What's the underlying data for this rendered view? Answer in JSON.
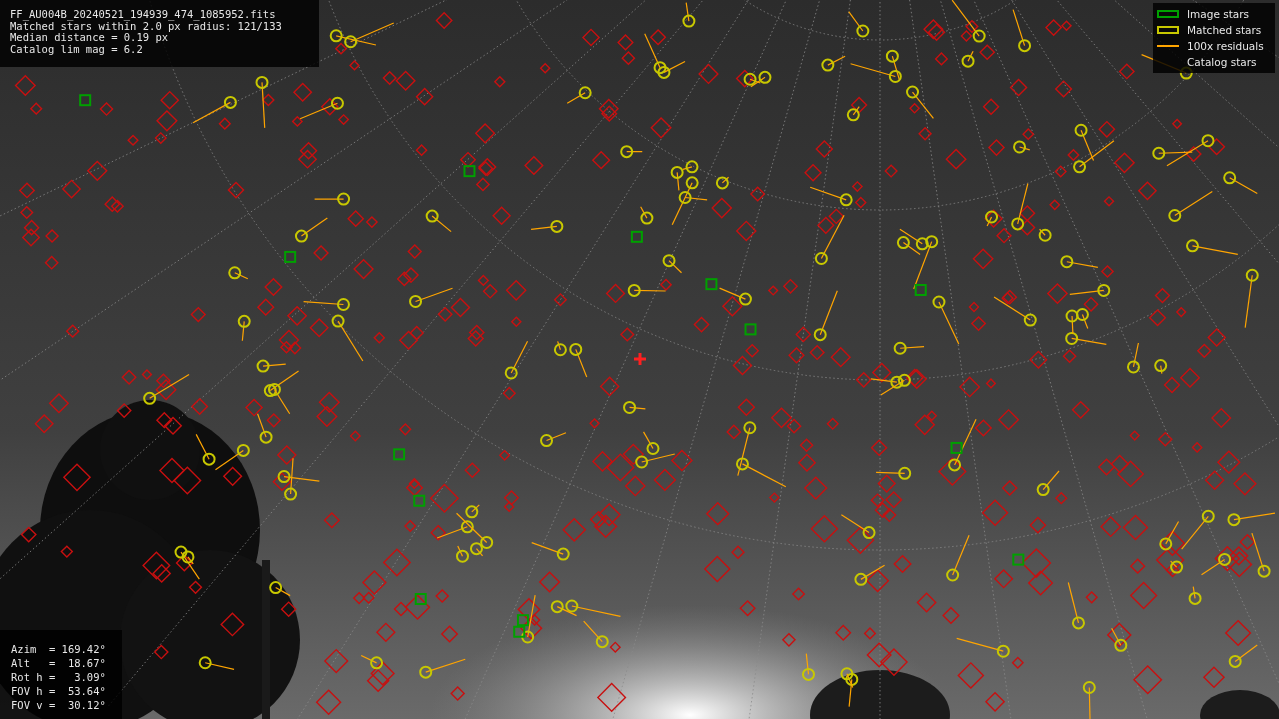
{
  "info_panel": {
    "lines": [
      "FF_AU004B_20240521_194939_474_1085952.fits",
      "Matched stars within 2.0 px radius: 121/133",
      "Median distance = 0.19 px",
      "Catalog lim mag = 6.2"
    ]
  },
  "legend": {
    "items": [
      {
        "label": "Image stars"
      },
      {
        "kind": "matched",
        "label": "Matched stars"
      },
      {
        "kind": "residual",
        "label": "100x residuals"
      },
      {
        "kind": "catalog",
        "label": "Catalog stars"
      }
    ]
  },
  "pointing_panel": {
    "lines": [
      "Azim  = 169.42°",
      "Alt   =  18.67°",
      "Rot h =   3.09°",
      "FOV h =  53.64°",
      "FOV v =  30.12°"
    ]
  }
}
